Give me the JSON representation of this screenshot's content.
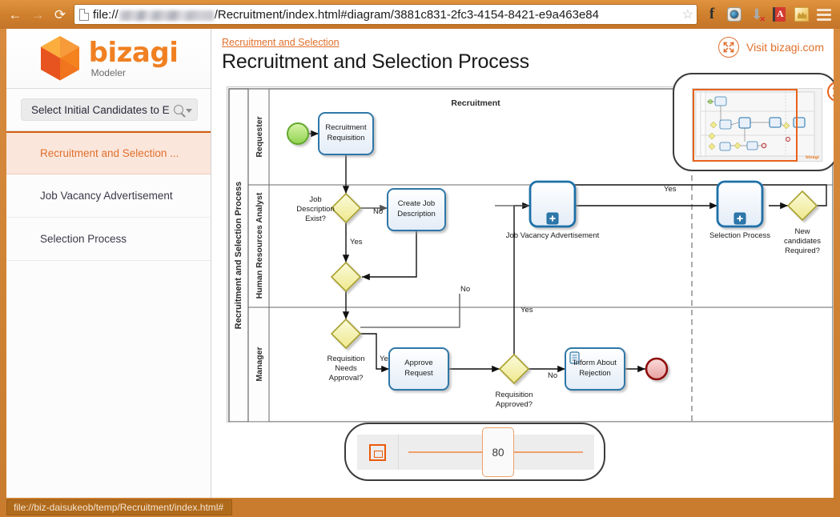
{
  "browser": {
    "back_icon": "back-arrow",
    "forward_icon": "forward-arrow",
    "reload_icon": "reload",
    "url_prefix": "file://",
    "url_suffix": "/Recruitment/index.html#diagram/3881c831-2fc3-4154-8421-e9a463e84",
    "star_glyph": "☆",
    "extensions": [
      {
        "name": "facebook-icon",
        "glyph": "f"
      },
      {
        "name": "instagram-icon",
        "glyph": ""
      },
      {
        "name": "download-icon",
        "glyph": "⬇"
      },
      {
        "name": "dictionary-icon",
        "glyph": "A"
      },
      {
        "name": "frog-icon",
        "glyph": ""
      },
      {
        "name": "menu-icon",
        "glyph": ""
      }
    ]
  },
  "sidebar": {
    "logo_name": "bizagi",
    "logo_sub": "Modeler",
    "search": {
      "value": "Select Initial Candidates to E",
      "placeholder": "Search"
    },
    "items": [
      {
        "label": "Recruitment and Selection ...",
        "active": true
      },
      {
        "label": "Job Vacancy Advertisement",
        "active": false
      },
      {
        "label": "Selection Process",
        "active": false
      }
    ]
  },
  "header": {
    "breadcrumb": "Recruitment and Selection",
    "title": "Recruitment and Selection Process",
    "visit_label": "Visit bizagi.com"
  },
  "zoom": {
    "value": "80",
    "fit_label": "fit-to-page"
  },
  "statusbar": {
    "text": "file://biz-daisukeob/temp/Recruitment/index.html#"
  },
  "diagram": {
    "pool_label": "Recruitment and Selection Process",
    "phase_label": "Recruitment",
    "lanes": [
      {
        "label": "Requester"
      },
      {
        "label": "Human Resources Analyst"
      },
      {
        "label": "Manager"
      }
    ],
    "nodes": [
      {
        "id": "start",
        "type": "start-event",
        "label": ""
      },
      {
        "id": "req",
        "type": "task",
        "label": "Recruitment\nRequisition"
      },
      {
        "id": "gw1",
        "type": "gateway",
        "label": "Job\nDescription\nExist?"
      },
      {
        "id": "createjd",
        "type": "task",
        "label": "Create Job\nDescription"
      },
      {
        "id": "gw2",
        "type": "gateway",
        "label": ""
      },
      {
        "id": "gw3",
        "type": "gateway",
        "label": "Requisition\nNeeds\nApproval?"
      },
      {
        "id": "approve",
        "type": "task",
        "label": "Approve\nRequest"
      },
      {
        "id": "gw4",
        "type": "gateway",
        "label": "Requisition\nApproved?"
      },
      {
        "id": "inform",
        "type": "task-script",
        "label": "Inform About\nRejection"
      },
      {
        "id": "end",
        "type": "end-event",
        "label": ""
      },
      {
        "id": "jobvac",
        "type": "subprocess",
        "label": "Job Vacancy Advertisement"
      },
      {
        "id": "selproc",
        "type": "subprocess",
        "label": "Selection Process"
      },
      {
        "id": "gw5",
        "type": "gateway",
        "label": "New\ncandidates\nRequired?"
      }
    ],
    "flow_labels": [
      {
        "id": "f-no-1",
        "text": "No"
      },
      {
        "id": "f-yes-1",
        "text": "Yes"
      },
      {
        "id": "f-yes-2",
        "text": "Yes"
      },
      {
        "id": "f-no-2",
        "text": "No"
      },
      {
        "id": "f-yes-3",
        "text": "Yes"
      },
      {
        "id": "f-no-3",
        "text": "No"
      },
      {
        "id": "f-yes-4",
        "text": "Yes"
      }
    ]
  },
  "colors": {
    "accent": "#e8621c",
    "brand_orange": "#f08022",
    "chrome": "#cf7f2c",
    "task_border": "#2f77a8",
    "gateway_fill": "#f5f0a8",
    "start_fill": "#a8e06a",
    "end_stroke": "#8f1010"
  }
}
